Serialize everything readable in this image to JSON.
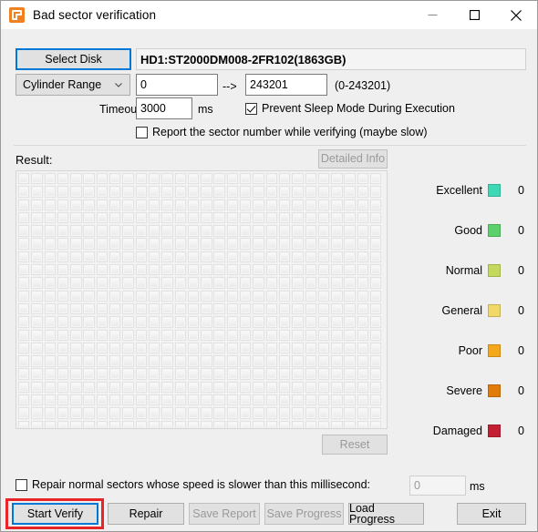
{
  "window": {
    "title": "Bad sector verification",
    "icon": "app-orange-g-icon",
    "controls": {
      "minimize": "minimize-icon",
      "maximize": "maximize-icon",
      "close": "close-icon"
    }
  },
  "disk": {
    "select_button": "Select Disk",
    "info": "HD1:ST2000DM008-2FR102(1863GB)"
  },
  "range": {
    "mode": "Cylinder Range",
    "mode_options": [
      "Cylinder Range"
    ],
    "start": "0",
    "arrow": "-->",
    "end": "243201",
    "hint": "(0-243201)"
  },
  "timeout": {
    "label": "Timeout:",
    "value": "3000",
    "unit": "ms"
  },
  "options": {
    "prevent_sleep": {
      "label": "Prevent Sleep Mode During Execution",
      "checked": true
    },
    "report_sector": {
      "label": "Report the sector number while verifying (maybe slow)",
      "checked": false
    }
  },
  "result": {
    "label": "Result:",
    "detailed_info_button": "Detailed Info",
    "detailed_info_enabled": false,
    "reset_button": "Reset",
    "reset_enabled": false,
    "grid": {
      "columns": 28,
      "rows": 20
    }
  },
  "legend": [
    {
      "name": "Excellent",
      "color": "#3fd8b4",
      "count": "0"
    },
    {
      "name": "Good",
      "color": "#5cd06a",
      "count": "0"
    },
    {
      "name": "Normal",
      "color": "#c2d95c",
      "count": "0"
    },
    {
      "name": "General",
      "color": "#f0d86a",
      "count": "0"
    },
    {
      "name": "Poor",
      "color": "#f5a81c",
      "count": "0"
    },
    {
      "name": "Severe",
      "color": "#e07c0a",
      "count": "0"
    },
    {
      "name": "Damaged",
      "color": "#c42033",
      "count": "0"
    }
  ],
  "repair_option": {
    "label": "Repair normal sectors whose speed is slower than this millisecond:",
    "checked": false,
    "value": "0",
    "unit": "ms"
  },
  "footer": {
    "start_verify": {
      "label": "Start Verify",
      "enabled": true,
      "focused": true,
      "highlighted": true
    },
    "repair": {
      "label": "Repair",
      "enabled": true
    },
    "save_report": {
      "label": "Save Report",
      "enabled": false
    },
    "save_progress": {
      "label": "Save Progress",
      "enabled": false
    },
    "load_progress": {
      "label": "Load Progress",
      "enabled": true
    },
    "exit": {
      "label": "Exit",
      "enabled": true
    }
  },
  "colors": {
    "accent": "#0078d7",
    "highlight": "#e8262a",
    "window_bg": "#efeff0"
  }
}
